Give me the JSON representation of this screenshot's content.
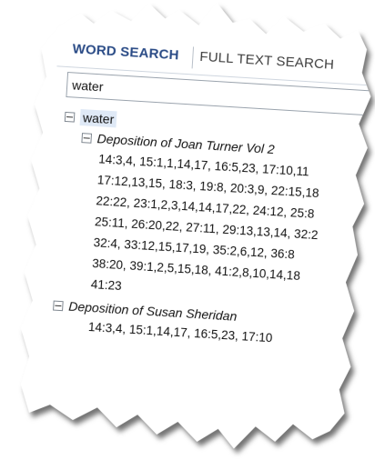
{
  "tabs": {
    "word_search": "WORD SEARCH",
    "full_text_search": "FULL TEXT SEARCH"
  },
  "search": {
    "value": "water"
  },
  "tree": {
    "root": "water",
    "documents": [
      {
        "title": "Deposition of Joan Turner Vol 2",
        "lines": [
          "14:3,4, 15:1,1,14,17, 16:5,23, 17:10,11",
          "17:12,13,15, 18:3, 19:8, 20:3,9, 22:15,18",
          "22:22, 23:1,2,3,14,14,17,22, 24:12, 25:8",
          "25:11, 26:20,22, 27:11, 29:13,13,14, 32:2",
          "32:4, 33:12,15,17,19, 35:2,6,12, 36:8",
          "38:20, 39:1,2,5,15,18, 41:2,8,10,14,18",
          "41:23"
        ]
      },
      {
        "title": "Deposition of Susan Sheridan",
        "lines": [
          "14:3,4, 15:1,14,17, 16:5,23, 17:10"
        ]
      }
    ]
  },
  "colors": {
    "active_tab": "#2a4b86",
    "root_highlight": "#dfe9f6"
  }
}
